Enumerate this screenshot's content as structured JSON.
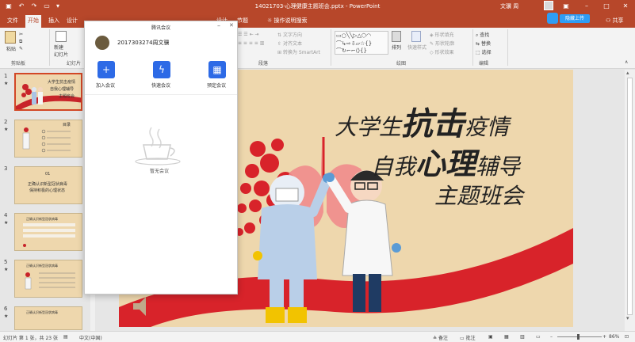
{
  "window": {
    "title": "14021703-心理健康主题班会.pptx - PowerPoint",
    "user": "文骥 周",
    "sync_button": "隐藏上传"
  },
  "tabs": [
    "文件",
    "开始",
    "插入",
    "设计",
    "切换",
    "动画",
    "幻灯片放映",
    "审阅",
    "视图",
    "帮助",
    "设计",
    "节题"
  ],
  "active_tab": "开始",
  "tell_me": "操作说明搜索",
  "share": "共享",
  "ribbon": {
    "clipboard": {
      "paste": "粘贴",
      "label": "剪贴板"
    },
    "slides": {
      "new_slide": "新建\n幻灯片",
      "label": "幻灯片"
    },
    "paragraph": {
      "label": "段落",
      "text_direction": "文字方向",
      "align_text": "对齐文本",
      "smartart": "转换为 SmartArt"
    },
    "drawing": {
      "label": "绘图",
      "arrange": "排列",
      "quick_styles": "快速样式",
      "shape_fill": "形状填充",
      "shape_outline": "形状轮廓",
      "shape_effects": "形状效果"
    },
    "editing": {
      "label": "编辑",
      "find": "查找",
      "replace": "替换",
      "select": "选择"
    }
  },
  "thumbnails": [
    {
      "num": "1",
      "lines": [
        "大学生抗击疫情",
        "自我心理辅导",
        "主题班会"
      ]
    },
    {
      "num": "2",
      "lines": [
        "目录"
      ]
    },
    {
      "num": "3",
      "lines": [
        "01",
        "正确认识新型冠状病毒",
        "保持积极的心理状态"
      ]
    },
    {
      "num": "4",
      "lines": [
        "正确认识新型冠状病毒"
      ]
    },
    {
      "num": "5",
      "lines": [
        "正确认识新型冠状病毒"
      ]
    },
    {
      "num": "6",
      "lines": [
        "正确认识新型冠状病毒"
      ]
    }
  ],
  "slide": {
    "line1_a": "大学生",
    "line1_b": "抗击",
    "line1_c": "疫情",
    "line2_a": "自我",
    "line2_b": "心理",
    "line2_c": "辅导",
    "line3": "主题班会"
  },
  "meeting": {
    "window_title": "腾讯会议",
    "user_name": "2017303274周文骥",
    "join": "加入会议",
    "quick": "快速会议",
    "schedule": "预定会议",
    "empty": "暂无会议"
  },
  "status": {
    "slide_info": "幻灯片 第 1 张，共 23 张",
    "language": "中文(中国)",
    "notes": "备注",
    "comments": "批注",
    "zoom": "86%"
  },
  "colors": {
    "accent": "#b7472a",
    "meeting_blue": "#2d6ae6",
    "slide_bg": "#eed7ad"
  }
}
